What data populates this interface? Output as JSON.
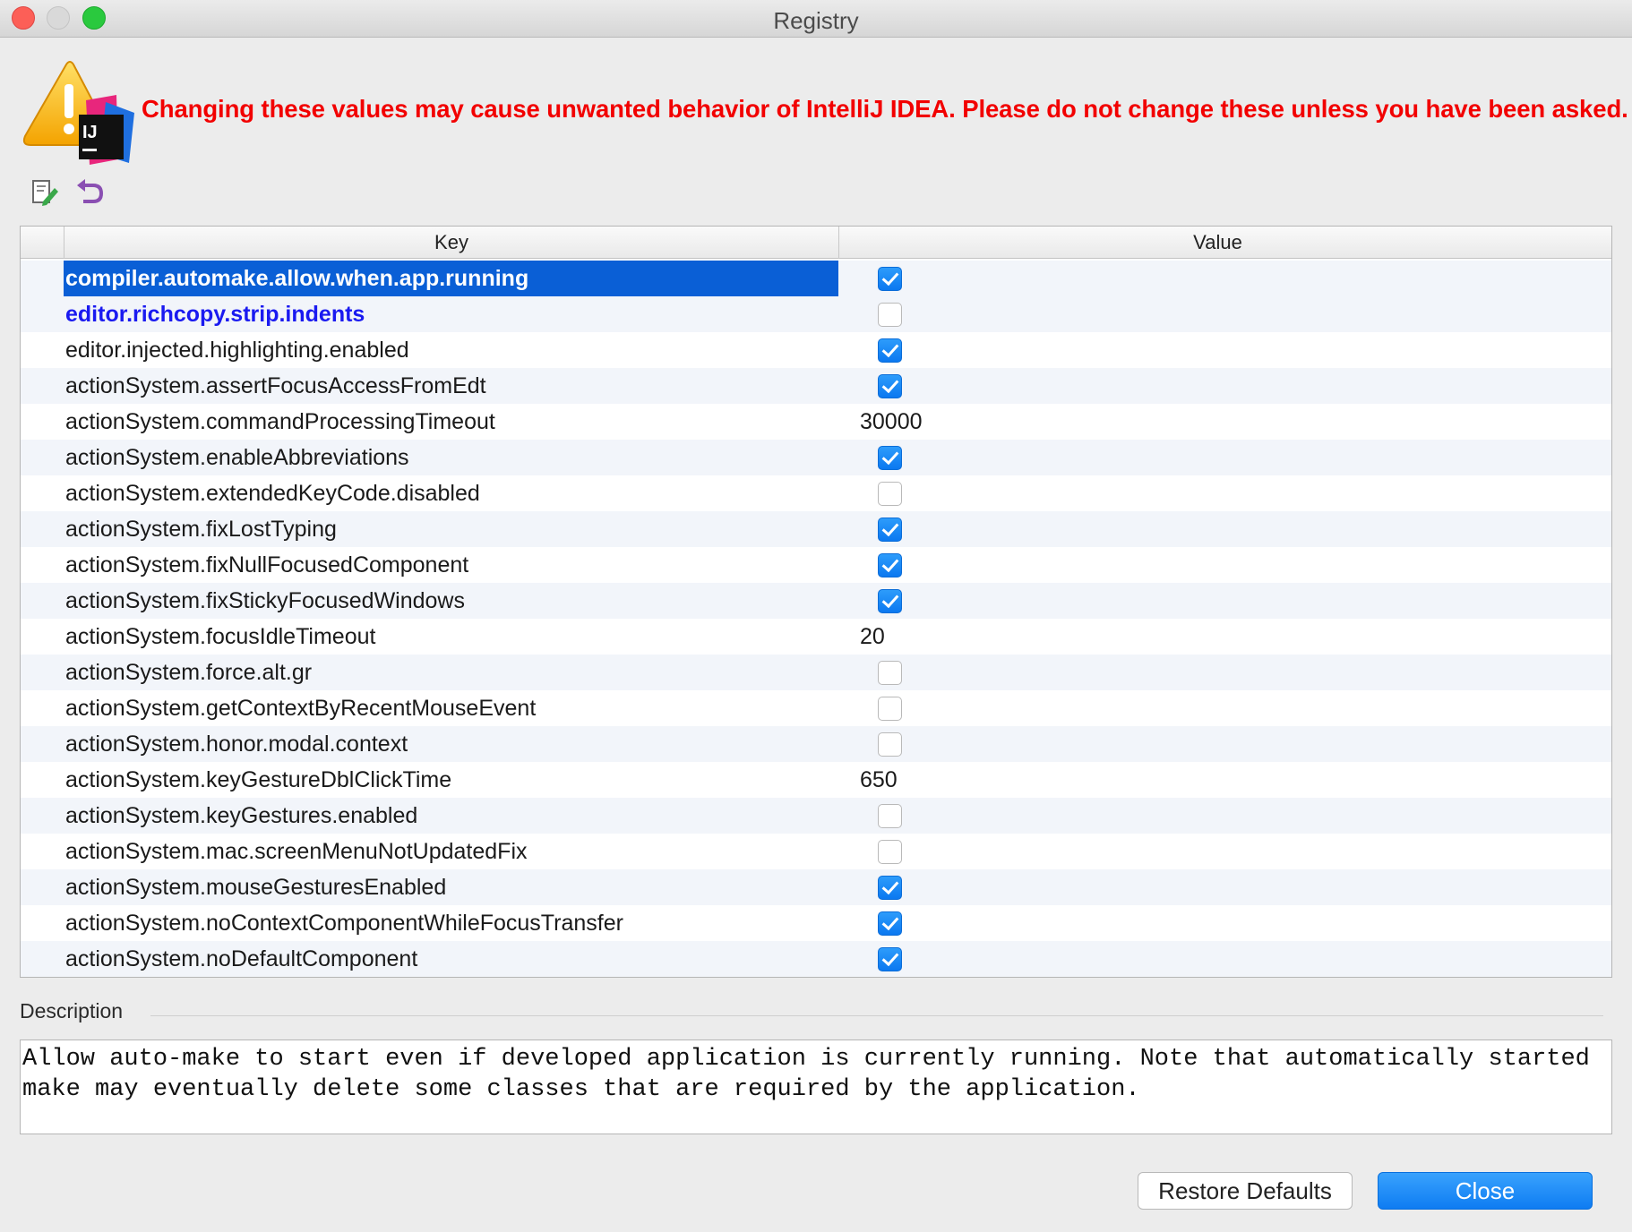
{
  "window": {
    "title": "Registry"
  },
  "warning": {
    "text": "Changing these values may cause unwanted behavior of IntelliJ IDEA. Please do not change these unless you have been asked.",
    "icon_badge": "IJ"
  },
  "colors": {
    "warning": "#f20000",
    "selection": "#0a5fd6",
    "modified": "#1a1af0",
    "accent": "#0e7cf2"
  },
  "toolbar": {
    "edit_icon": "edit-icon",
    "revert_icon": "revert-icon"
  },
  "table": {
    "columns": {
      "key": "Key",
      "value": "Value"
    },
    "rows": [
      {
        "key": "compiler.automake.allow.when.app.running",
        "type": "bool",
        "value": true,
        "state": "selected"
      },
      {
        "key": "editor.richcopy.strip.indents",
        "type": "bool",
        "value": false,
        "state": "modified"
      },
      {
        "key": "editor.injected.highlighting.enabled",
        "type": "bool",
        "value": true
      },
      {
        "key": "actionSystem.assertFocusAccessFromEdt",
        "type": "bool",
        "value": true
      },
      {
        "key": "actionSystem.commandProcessingTimeout",
        "type": "text",
        "value": "30000"
      },
      {
        "key": "actionSystem.enableAbbreviations",
        "type": "bool",
        "value": true
      },
      {
        "key": "actionSystem.extendedKeyCode.disabled",
        "type": "bool",
        "value": false
      },
      {
        "key": "actionSystem.fixLostTyping",
        "type": "bool",
        "value": true
      },
      {
        "key": "actionSystem.fixNullFocusedComponent",
        "type": "bool",
        "value": true
      },
      {
        "key": "actionSystem.fixStickyFocusedWindows",
        "type": "bool",
        "value": true
      },
      {
        "key": "actionSystem.focusIdleTimeout",
        "type": "text",
        "value": "20"
      },
      {
        "key": "actionSystem.force.alt.gr",
        "type": "bool",
        "value": false
      },
      {
        "key": "actionSystem.getContextByRecentMouseEvent",
        "type": "bool",
        "value": false
      },
      {
        "key": "actionSystem.honor.modal.context",
        "type": "bool",
        "value": false
      },
      {
        "key": "actionSystem.keyGestureDblClickTime",
        "type": "text",
        "value": "650"
      },
      {
        "key": "actionSystem.keyGestures.enabled",
        "type": "bool",
        "value": false
      },
      {
        "key": "actionSystem.mac.screenMenuNotUpdatedFix",
        "type": "bool",
        "value": false
      },
      {
        "key": "actionSystem.mouseGesturesEnabled",
        "type": "bool",
        "value": true
      },
      {
        "key": "actionSystem.noContextComponentWhileFocusTransfer",
        "type": "bool",
        "value": true
      },
      {
        "key": "actionSystem.noDefaultComponent",
        "type": "bool",
        "value": true
      }
    ]
  },
  "description": {
    "label": "Description",
    "text": "Allow auto-make to start even if developed application is currently running. Note that automatically started make may eventually delete some classes that are required by the application."
  },
  "buttons": {
    "restore": "Restore Defaults",
    "close": "Close"
  }
}
